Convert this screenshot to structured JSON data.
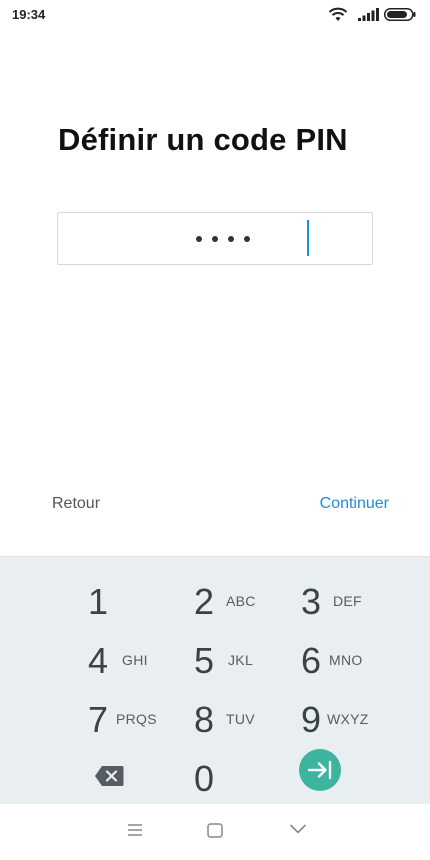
{
  "status_bar": {
    "time": "19:34",
    "icons": [
      "wifi-icon",
      "signal-icon",
      "battery-icon"
    ]
  },
  "title": "Définir un code PIN",
  "pin_input": {
    "masked_length": 4,
    "dot": "•"
  },
  "actions": {
    "back_label": "Retour",
    "continue_label": "Continuer"
  },
  "keypad": {
    "keys": [
      {
        "digit": "1",
        "letters": ""
      },
      {
        "digit": "2",
        "letters": "ABC"
      },
      {
        "digit": "3",
        "letters": "DEF"
      },
      {
        "digit": "4",
        "letters": "GHI"
      },
      {
        "digit": "5",
        "letters": "JKL"
      },
      {
        "digit": "6",
        "letters": "MNO"
      },
      {
        "digit": "7",
        "letters": "PRQS"
      },
      {
        "digit": "8",
        "letters": "TUV"
      },
      {
        "digit": "9",
        "letters": "WXYZ"
      }
    ],
    "zero": {
      "digit": "0"
    },
    "backspace_icon": "backspace-icon",
    "enter_icon": "enter-arrow-icon"
  },
  "nav_bar": {
    "icons": [
      "menu-icon",
      "home-square-icon",
      "back-chevron-icon"
    ]
  },
  "colors": {
    "accent": "#1a8fd8",
    "keypad_bg": "#e9eef0",
    "enter_button": "#3cb4a0"
  }
}
